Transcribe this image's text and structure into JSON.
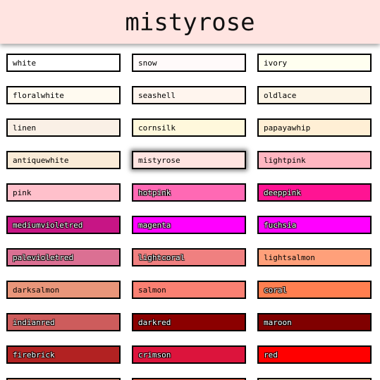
{
  "header": {
    "title": "mistyrose",
    "background": "#ffe4e1"
  },
  "selected": "mistyrose",
  "swatches": [
    {
      "name": "white",
      "color": "#ffffff",
      "dark": false
    },
    {
      "name": "snow",
      "color": "#fffafa",
      "dark": false
    },
    {
      "name": "ivory",
      "color": "#fffff0",
      "dark": false
    },
    {
      "name": "floralwhite",
      "color": "#fffaf0",
      "dark": false
    },
    {
      "name": "seashell",
      "color": "#fff5ee",
      "dark": false
    },
    {
      "name": "oldlace",
      "color": "#fdf5e6",
      "dark": false
    },
    {
      "name": "linen",
      "color": "#faf0e6",
      "dark": false
    },
    {
      "name": "cornsilk",
      "color": "#fff8dc",
      "dark": false
    },
    {
      "name": "papayawhip",
      "color": "#ffefd5",
      "dark": false
    },
    {
      "name": "antiquewhite",
      "color": "#faebd7",
      "dark": false
    },
    {
      "name": "mistyrose",
      "color": "#ffe4e1",
      "dark": false
    },
    {
      "name": "lightpink",
      "color": "#ffb6c1",
      "dark": false
    },
    {
      "name": "pink",
      "color": "#ffc0cb",
      "dark": false
    },
    {
      "name": "hotpink",
      "color": "#ff69b4",
      "dark": true
    },
    {
      "name": "deeppink",
      "color": "#ff1493",
      "dark": true
    },
    {
      "name": "mediumvioletred",
      "color": "#c71585",
      "dark": true
    },
    {
      "name": "magenta",
      "color": "#ff00ff",
      "dark": true
    },
    {
      "name": "fuchsia",
      "color": "#ff00ff",
      "dark": true
    },
    {
      "name": "palevioletred",
      "color": "#db7093",
      "dark": true
    },
    {
      "name": "lightcoral",
      "color": "#f08080",
      "dark": true
    },
    {
      "name": "lightsalmon",
      "color": "#ffa07a",
      "dark": false
    },
    {
      "name": "darksalmon",
      "color": "#e9967a",
      "dark": false
    },
    {
      "name": "salmon",
      "color": "#fa8072",
      "dark": false
    },
    {
      "name": "coral",
      "color": "#ff7f50",
      "dark": true
    },
    {
      "name": "indianred",
      "color": "#cd5c5c",
      "dark": true
    },
    {
      "name": "darkred",
      "color": "#8b0000",
      "dark": true
    },
    {
      "name": "maroon",
      "color": "#800000",
      "dark": true
    },
    {
      "name": "firebrick",
      "color": "#b22222",
      "dark": true
    },
    {
      "name": "crimson",
      "color": "#dc143c",
      "dark": true
    },
    {
      "name": "red",
      "color": "#ff0000",
      "dark": true
    },
    {
      "name": "",
      "color": "#e9967a",
      "dark": false
    },
    {
      "name": "",
      "color": "#ff6347",
      "dark": true
    },
    {
      "name": "",
      "color": "#f5deb3",
      "dark": false
    }
  ]
}
